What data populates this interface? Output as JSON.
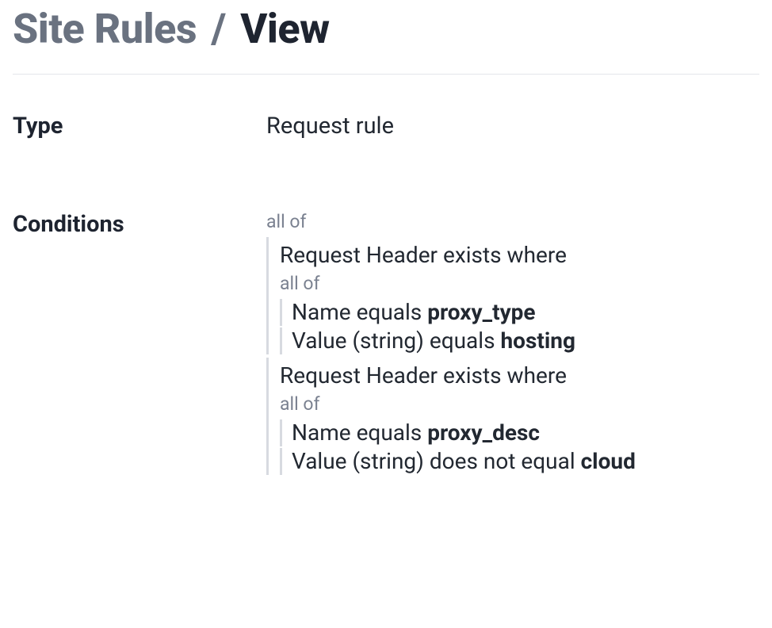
{
  "breadcrumb": {
    "root": "Site Rules",
    "separator": "/",
    "current": "View"
  },
  "fields": {
    "type": {
      "label": "Type",
      "value": "Request rule"
    },
    "conditions": {
      "label": "Conditions",
      "join": "all of",
      "groups": [
        {
          "header": "Request Header exists where",
          "join": "all of",
          "lines": [
            {
              "field": "Name",
              "op": "equals",
              "value": "proxy_type"
            },
            {
              "field": "Value (string)",
              "op": "equals",
              "value": "hosting"
            }
          ]
        },
        {
          "header": "Request Header exists where",
          "join": "all of",
          "lines": [
            {
              "field": "Name",
              "op": "equals",
              "value": "proxy_desc"
            },
            {
              "field": "Value (string)",
              "op": "does not equal",
              "value": "cloud"
            }
          ]
        }
      ]
    }
  }
}
